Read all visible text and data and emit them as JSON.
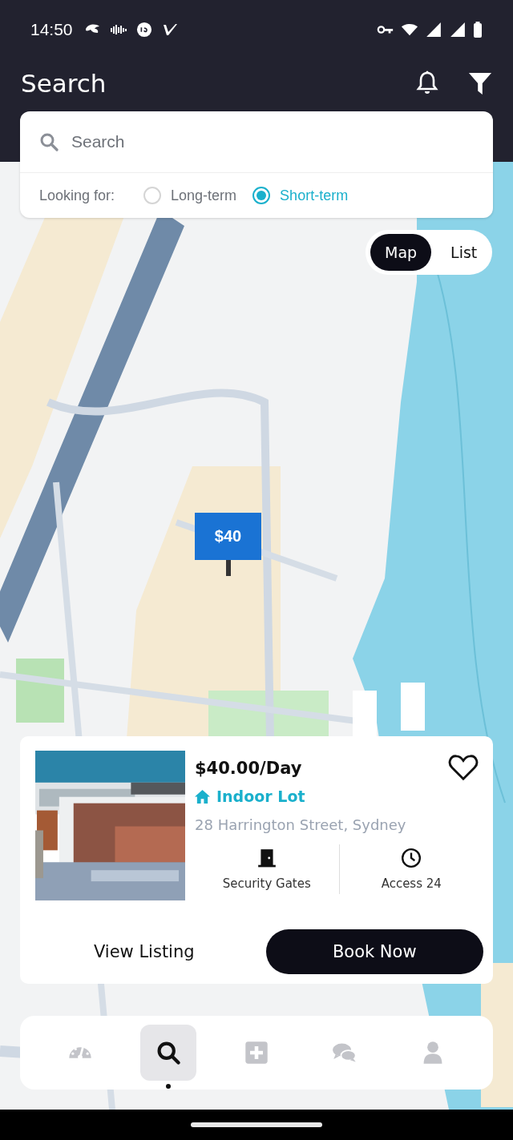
{
  "status_bar": {
    "time": "14:50"
  },
  "header": {
    "title": "Search"
  },
  "search": {
    "placeholder": "Search",
    "label": "Looking for:",
    "options": [
      {
        "label": "Long-term",
        "selected": false
      },
      {
        "label": "Short-term",
        "selected": true
      }
    ]
  },
  "view_toggle": [
    {
      "label": "Map",
      "selected": true
    },
    {
      "label": "List",
      "selected": false
    }
  ],
  "map": {
    "pins": [
      {
        "price": "$40"
      }
    ]
  },
  "listing": {
    "price": "$40.00/Day",
    "type": "Indoor Lot",
    "address": "28 Harrington Street, Sydney",
    "favorite": false,
    "features": [
      {
        "kind": "gate",
        "label": "Security Gates"
      },
      {
        "kind": "clock",
        "label": "Access 24"
      }
    ],
    "buttons": [
      {
        "kind": "text",
        "label": "View Listing"
      },
      {
        "kind": "primary",
        "label": "Book Now"
      }
    ]
  },
  "nav": [
    {
      "kind": "dashboard",
      "selected": false
    },
    {
      "kind": "search",
      "selected": true
    },
    {
      "kind": "add",
      "selected": false
    },
    {
      "kind": "chat",
      "selected": false
    },
    {
      "kind": "profile",
      "selected": false
    }
  ]
}
